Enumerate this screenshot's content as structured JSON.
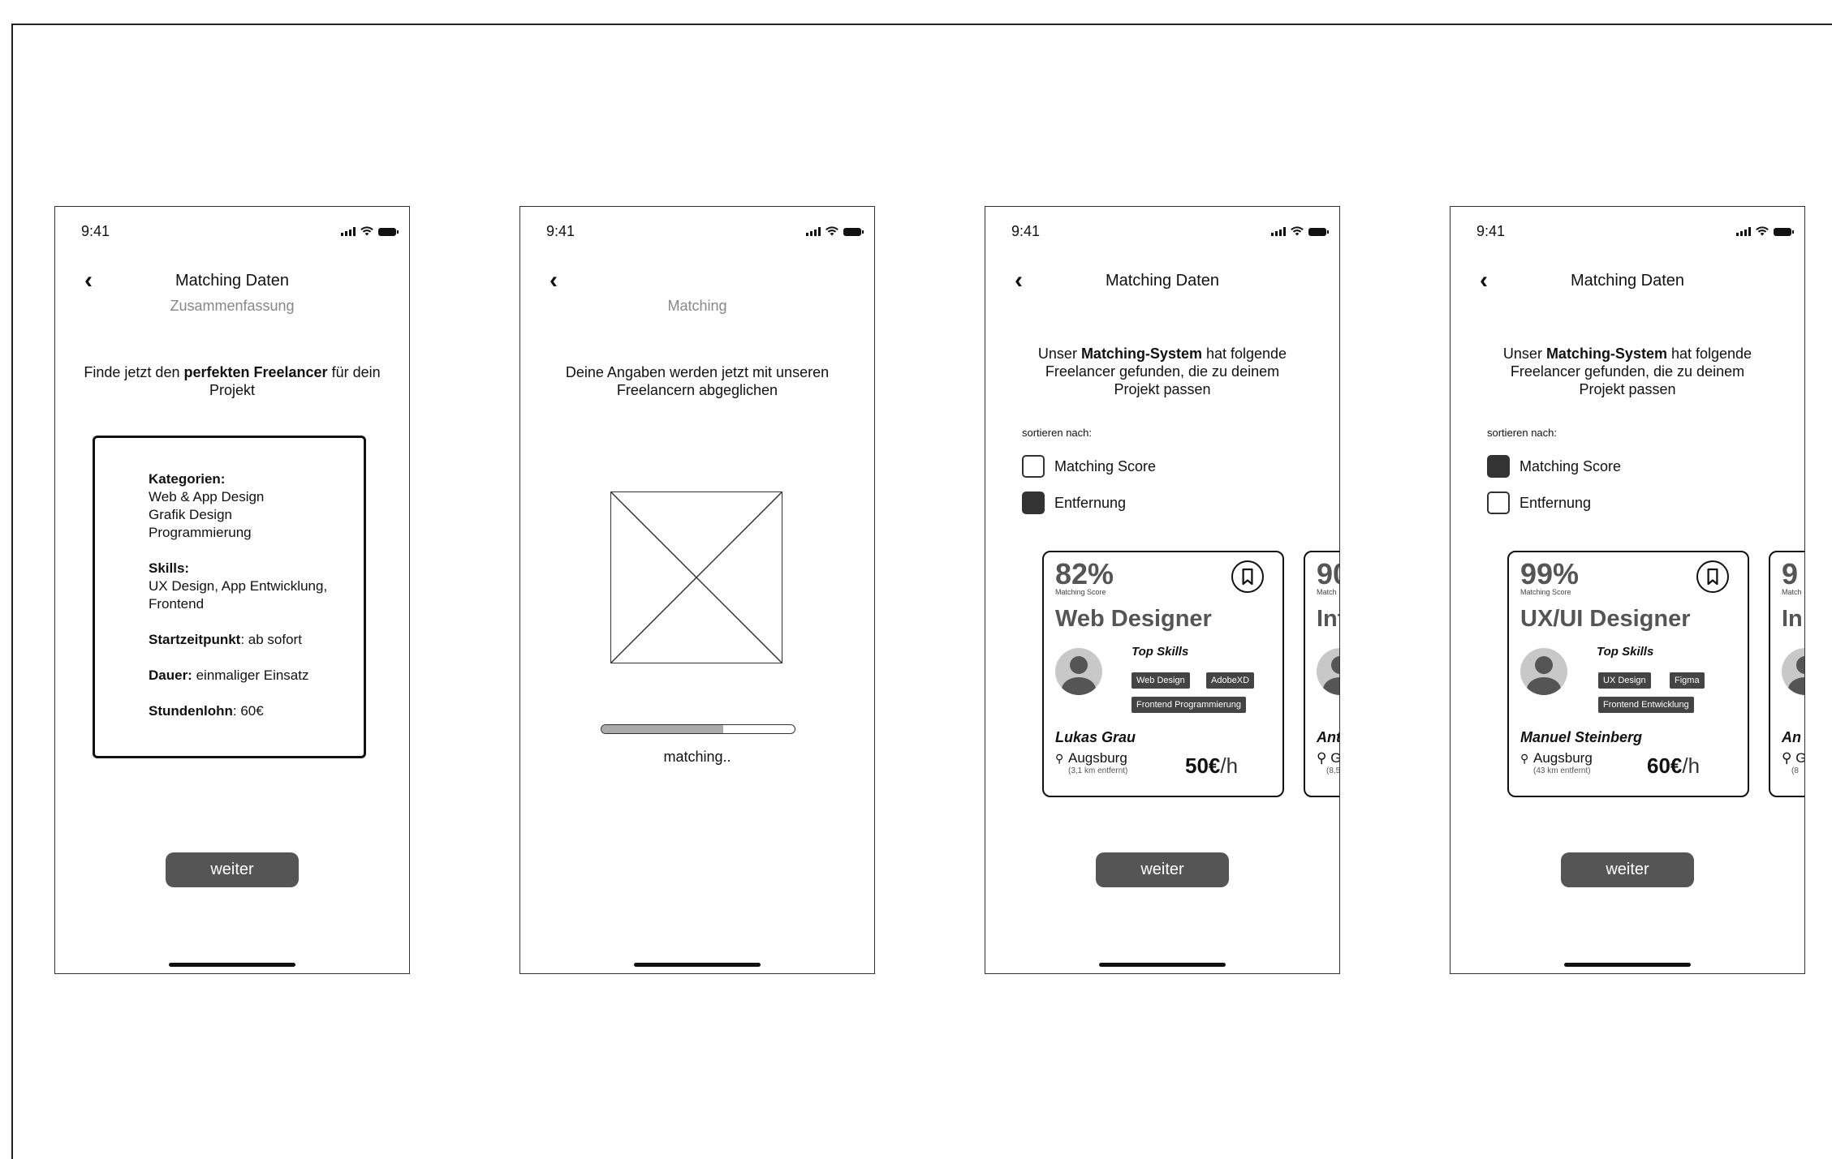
{
  "status_bar": {
    "time": "9:41"
  },
  "screens": [
    {
      "title": "Matching Daten",
      "subtitle": "Zusammenfassung",
      "intro": {
        "pre": "Finde jetzt den ",
        "bold": "perfekten Freelancer",
        "post": " für dein Projekt"
      },
      "summary": {
        "categories_label": "Kategorien:",
        "categories": [
          "Web & App Design",
          "Grafik Design",
          "Programmierung"
        ],
        "skills_label": "Skills:",
        "skills_value": "UX Design, App Entwicklung, Frontend",
        "start_label": "Startzeitpunkt",
        "start_value": ": ab sofort",
        "duration_label": "Dauer:",
        "duration_value": " einmaliger Einsatz",
        "rate_label": "Stundenlohn",
        "rate_value": ": 60€"
      },
      "button": "weiter"
    },
    {
      "subtitle": "Matching",
      "intro": "Deine Angaben werden jetzt mit unseren Freelancern abgeglichen",
      "progress": 0.63,
      "progress_label": "matching.."
    },
    {
      "title": "Matching Daten",
      "intro": {
        "pre": "Unser ",
        "bold": "Matching-System",
        "post": " hat folgende Freelancer gefunden, die zu deinem Projekt passen"
      },
      "sort_label": "sortieren nach:",
      "sort_options": [
        {
          "label": "Matching Score",
          "checked": false
        },
        {
          "label": "Entfernung",
          "checked": true
        }
      ],
      "card": {
        "score": "82%",
        "score_label": "Matching Score",
        "role": "Web Designer",
        "top_skills_label": "Top Skills",
        "tags": [
          "Web Design",
          "AdobeXD",
          "Frontend Programmierung"
        ],
        "name": "Lukas Grau",
        "city": "Augsburg",
        "distance": "(3,1 km entfernt)",
        "price": "50€",
        "per_hour": "/h"
      },
      "peek": {
        "score": "90",
        "score_label": "Match",
        "role": "Int",
        "name": "Ant",
        "city": "Ge",
        "distance": "(8,5"
      },
      "button": "weiter"
    },
    {
      "title": "Matching Daten",
      "intro": {
        "pre": "Unser ",
        "bold": "Matching-System",
        "post": " hat folgende Freelancer gefunden, die zu deinem Projekt passen"
      },
      "sort_label": "sortieren nach:",
      "sort_options": [
        {
          "label": "Matching Score",
          "checked": true
        },
        {
          "label": "Entfernung",
          "checked": false
        }
      ],
      "card": {
        "score": "99%",
        "score_label": "Matching Score",
        "role": "UX/UI Designer",
        "top_skills_label": "Top Skills",
        "tags": [
          "UX Design",
          "Figma",
          "Frontend Entwicklung"
        ],
        "name": "Manuel Steinberg",
        "city": "Augsburg",
        "distance": "(43 km entfernt)",
        "price": "60€",
        "per_hour": "/h"
      },
      "peek": {
        "score": "9",
        "score_label": "Match",
        "role": "In",
        "name": "An",
        "city": "G",
        "distance": "(8"
      },
      "button": "weiter"
    }
  ]
}
